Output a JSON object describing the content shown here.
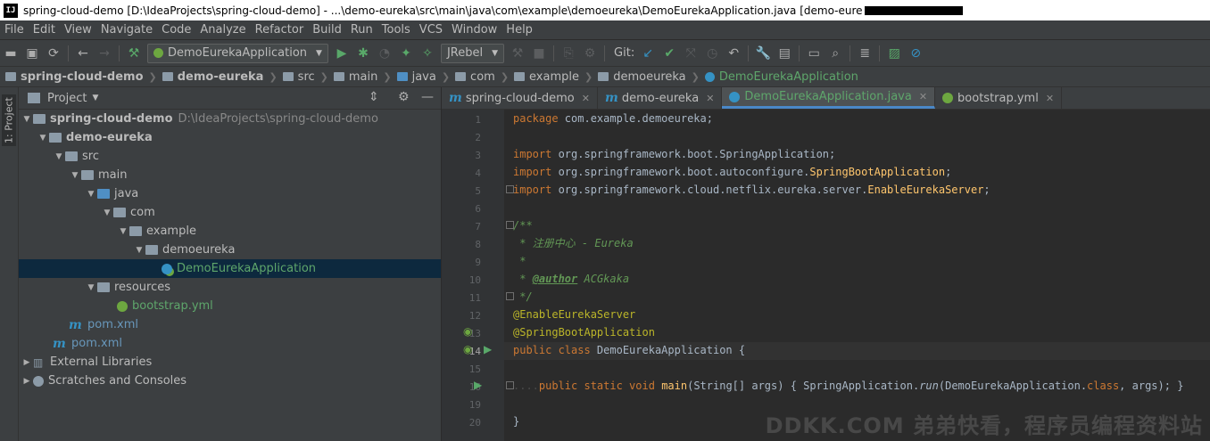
{
  "window": {
    "title": "spring-cloud-demo [D:\\IdeaProjects\\spring-cloud-demo] - ...\\demo-eureka\\src\\main\\java\\com\\example\\demoeureka\\DemoEurekaApplication.java [demo-eure",
    "app_icon": "IJ"
  },
  "menu": [
    "File",
    "Edit",
    "View",
    "Navigate",
    "Code",
    "Analyze",
    "Refactor",
    "Build",
    "Run",
    "Tools",
    "VCS",
    "Window",
    "Help"
  ],
  "toolbar": {
    "run_config": "DemoEurekaApplication",
    "jrebel": "JRebel",
    "git_label": "Git:"
  },
  "breadcrumbs": [
    "spring-cloud-demo",
    "demo-eureka",
    "src",
    "main",
    "java",
    "com",
    "example",
    "demoeureka",
    "DemoEurekaApplication"
  ],
  "sidebar": {
    "strip_label": "1: Project",
    "panel_title": "Project"
  },
  "tree": [
    {
      "label": "spring-cloud-demo",
      "path": "D:\\IdeaProjects\\spring-cloud-demo"
    },
    {
      "label": "demo-eureka"
    },
    {
      "label": "src"
    },
    {
      "label": "main"
    },
    {
      "label": "java"
    },
    {
      "label": "com"
    },
    {
      "label": "example"
    },
    {
      "label": "demoeureka"
    },
    {
      "label": "DemoEurekaApplication"
    },
    {
      "label": "resources"
    },
    {
      "label": "bootstrap.yml"
    },
    {
      "label": "pom.xml"
    },
    {
      "label": "pom.xml"
    },
    {
      "label": "External Libraries"
    },
    {
      "label": "Scratches and Consoles"
    }
  ],
  "tabs": [
    {
      "label": "spring-cloud-demo"
    },
    {
      "label": "demo-eureka"
    },
    {
      "label": "DemoEurekaApplication.java"
    },
    {
      "label": "bootstrap.yml"
    }
  ],
  "code": {
    "line_numbers": [
      "1",
      "2",
      "3",
      "4",
      "5",
      "6",
      "7",
      "8",
      "9",
      "10",
      "11",
      "12",
      "13",
      "14",
      "15",
      "16",
      "19",
      "20"
    ],
    "l1_kw": "package",
    "l1_rest": " com.example.demoeureka;",
    "l3_kw": "import",
    "l3_rest": " org.springframework.boot.SpringApplication;",
    "l4_kw": "import",
    "l4_rest": " org.springframework.boot.autoconfigure.",
    "l4_cls": "SpringBootApplication",
    "l4_end": ";",
    "l5_kw": "import",
    "l5_rest": " org.springframework.cloud.netflix.eureka.server.",
    "l5_cls": "EnableEurekaServer",
    "l5_end": ";",
    "l7": "/**",
    "l8": " * 注册中心 - Eureka",
    "l9": " *",
    "l10_pre": " * ",
    "l10_tag": "@author",
    "l10_val": " ACGkaka",
    "l11": " */",
    "l12": "@EnableEurekaServer",
    "l13": "@SpringBootApplication",
    "l14_kw": "public class ",
    "l14_name": "DemoEurekaApplication",
    "l14_end": " {",
    "l16_dots": "....",
    "l16_kw": "public static void ",
    "l16_m": "main",
    "l16_args": "(String[] args) { SpringApplication.",
    "l16_run": "run",
    "l16_args2": "(DemoEurekaApplication.",
    "l16_cls": "class",
    "l16_end": ", args); }",
    "l20": "}"
  },
  "watermark": "DDKK.COM 弟弟快看，程序员编程资料站"
}
